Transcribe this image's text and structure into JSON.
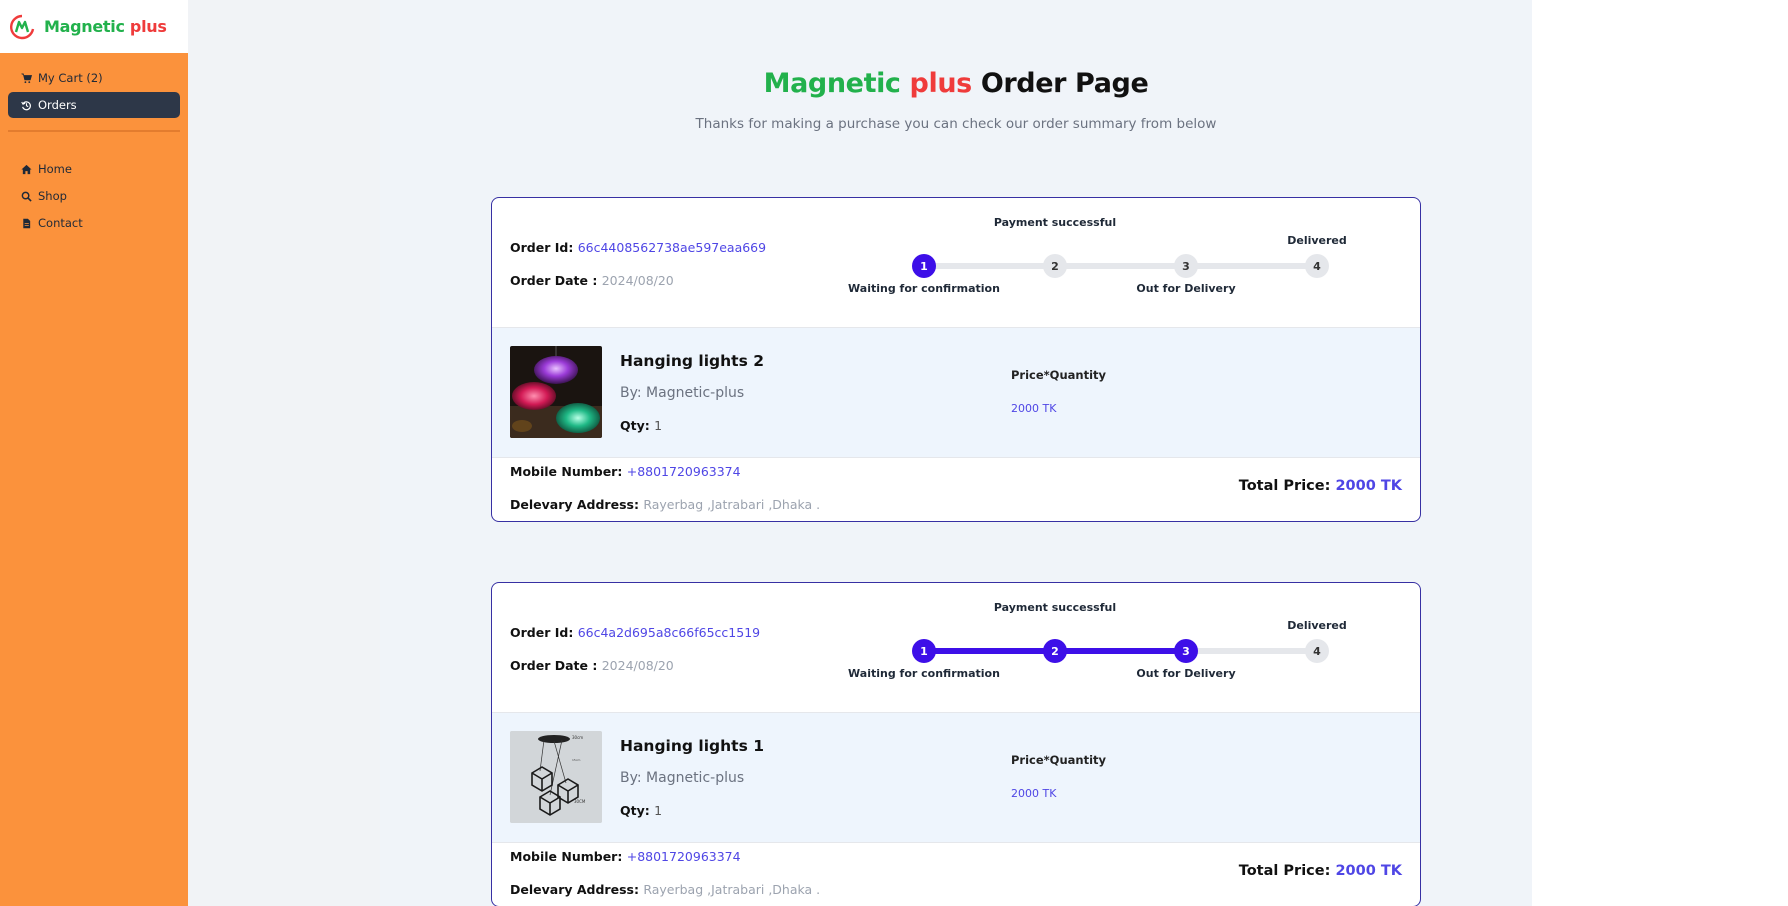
{
  "brand": {
    "name_part1": "Magnetic",
    "name_part2": "plus"
  },
  "sidebar": {
    "top_items": [
      {
        "label": "My Cart (2)",
        "icon": "cart-icon"
      },
      {
        "label": "Orders",
        "icon": "history-icon",
        "active": true
      }
    ],
    "bottom_items": [
      {
        "label": "Home",
        "icon": "home-icon"
      },
      {
        "label": "Shop",
        "icon": "search-icon"
      },
      {
        "label": "Contact",
        "icon": "document-icon"
      }
    ]
  },
  "page": {
    "title_part1": "Magnetic",
    "title_part2": "plus",
    "title_part3": "Order Page",
    "subtitle": "Thanks for making a purchase you can check our order summary from below"
  },
  "labels": {
    "order_id": "Order Id:",
    "order_date": "Order Date :",
    "price_quantity": "Price*Quantity",
    "qty": "Qty:",
    "mobile": "Mobile Number:",
    "address": "Delevary Address:",
    "total_price": "Total Price:"
  },
  "steps": {
    "labels": [
      "Waiting for confirmation",
      "Payment successful",
      "Out for Delivery",
      "Delivered"
    ],
    "numbers": [
      "1",
      "2",
      "3",
      "4"
    ]
  },
  "orders": [
    {
      "id": "66c4408562738ae597eaa669",
      "date": "2024/08/20",
      "current_step": 1,
      "item": {
        "name": "Hanging lights 2",
        "by": "By: Magnetic-plus",
        "qty": "1",
        "price_qty": "2000 TK"
      },
      "mobile": "+8801720963374",
      "address": "Rayerbag ,Jatrabari ,Dhaka .",
      "total": "2000 TK"
    },
    {
      "id": "66c4a2d695a8c66f65cc1519",
      "date": "2024/08/20",
      "current_step": 3,
      "item": {
        "name": "Hanging lights 1",
        "by": "By: Magnetic-plus",
        "qty": "1",
        "price_qty": "2000 TK"
      },
      "mobile": "+8801720963374",
      "address": "Rayerbag ,Jatrabari ,Dhaka .",
      "total": "2000 TK"
    }
  ],
  "colors": {
    "sidebar": "#fb923c",
    "accent": "#3d0fe8",
    "brand_green": "#22b14c",
    "brand_red": "#ef3b3b",
    "card_border": "#3730a3"
  }
}
